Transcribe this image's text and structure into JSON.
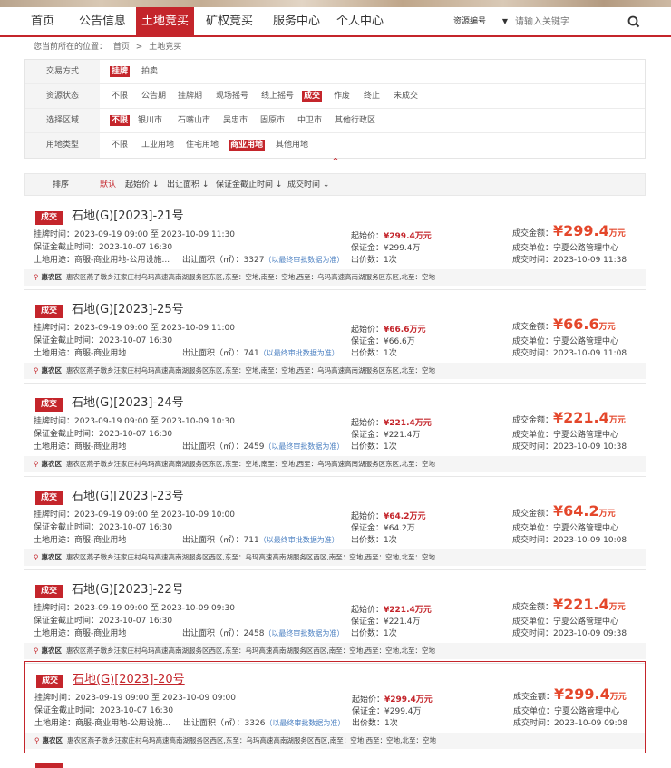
{
  "nav": {
    "items": [
      "首页",
      "公告信息",
      "土地竞买",
      "矿权竞买",
      "服务中心",
      "个人中心"
    ],
    "active_index": 2,
    "search_select": "资源编号",
    "search_placeholder": "请输入关键字"
  },
  "breadcrumb": {
    "prefix": "您当前所在的位置：",
    "home": "首页",
    "sep": ">",
    "current": "土地竞买"
  },
  "filters": [
    {
      "label": "交易方式",
      "options": [
        "挂牌",
        "拍卖"
      ],
      "selected": "挂牌"
    },
    {
      "label": "资源状态",
      "options": [
        "不限",
        "公告期",
        "挂牌期",
        "现场摇号",
        "线上摇号",
        "成交",
        "作废",
        "终止",
        "未成交"
      ],
      "selected": "成交"
    },
    {
      "label": "选择区域",
      "options": [
        "不限",
        "银川市",
        "石嘴山市",
        "吴忠市",
        "固原市",
        "中卫市",
        "其他行政区"
      ],
      "selected": "不限"
    },
    {
      "label": "用地类型",
      "options": [
        "不限",
        "工业用地",
        "住宅用地",
        "商业用地",
        "其他用地"
      ],
      "selected": "商业用地"
    }
  ],
  "sort": {
    "label": "排序",
    "options": [
      "默认",
      "起始价 ↓",
      "出让面积 ↓",
      "保证金截止时间 ↓",
      "成交时间 ↓"
    ],
    "active": "默认"
  },
  "listing_labels": {
    "badge": "成交",
    "listing_time": "挂牌时间：",
    "to": "至",
    "deposit_deadline": "保证金截止时间：",
    "land_use": "土地用途：",
    "area": "出让面积（㎡）：",
    "area_note": "（以最终审批数据为准）",
    "start_price": "起始价：",
    "deposit": "保证金：",
    "bid_count": "出价数：",
    "deal_amount": "成交金额：",
    "deal_unit": "成交单位：",
    "deal_time": "成交时间：",
    "district": "惠农区"
  },
  "listings": [
    {
      "title": "石地(G)[2023]-21号",
      "start": "2023-09-19 09:00",
      "end": "2023-10-09 11:30",
      "deposit_deadline": "2023-10-07 16:30",
      "land_use": "商服-商业用地-公用设施...",
      "area": "3327",
      "start_price": "¥299.4万元",
      "deposit": "¥299.4万",
      "bids": "1次",
      "deal_amount": "¥299.4",
      "deal_unit_suffix": "万元",
      "deal_unit": "宁夏公路管理中心",
      "deal_time": "2023-10-09 11:38",
      "location": "惠农区燕子墩乡汪家庄村乌玛高速高南湖服务区东区,东至：空地,南至：空地,西至：乌玛高速高南湖服务区东区,北至：空地"
    },
    {
      "title": "石地(G)[2023]-25号",
      "start": "2023-09-19 09:00",
      "end": "2023-10-09 11:00",
      "deposit_deadline": "2023-10-07 16:30",
      "land_use": "商服-商业用地",
      "area": "741",
      "start_price": "¥66.6万元",
      "deposit": "¥66.6万",
      "bids": "1次",
      "deal_amount": "¥66.6",
      "deal_unit_suffix": "万元",
      "deal_unit": "宁夏公路管理中心",
      "deal_time": "2023-10-09 11:08",
      "location": "惠农区燕子墩乡汪家庄村乌玛高速高南湖服务区东区,东至：空地,南至：空地,西至：乌玛高速高南湖服务区东区,北至：空地"
    },
    {
      "title": "石地(G)[2023]-24号",
      "start": "2023-09-19 09:00",
      "end": "2023-10-09 10:30",
      "deposit_deadline": "2023-10-07 16:30",
      "land_use": "商服-商业用地",
      "area": "2459",
      "start_price": "¥221.4万元",
      "deposit": "¥221.4万",
      "bids": "1次",
      "deal_amount": "¥221.4",
      "deal_unit_suffix": "万元",
      "deal_unit": "宁夏公路管理中心",
      "deal_time": "2023-10-09 10:38",
      "location": "惠农区燕子墩乡汪家庄村乌玛高速高南湖服务区东区,东至：空地,南至：空地,西至：乌玛高速高南湖服务区东区,北至：空地"
    },
    {
      "title": "石地(G)[2023]-23号",
      "start": "2023-09-19 09:00",
      "end": "2023-10-09 10:00",
      "deposit_deadline": "2023-10-07 16:30",
      "land_use": "商服-商业用地",
      "area": "711",
      "start_price": "¥64.2万元",
      "deposit": "¥64.2万",
      "bids": "1次",
      "deal_amount": "¥64.2",
      "deal_unit_suffix": "万元",
      "deal_unit": "宁夏公路管理中心",
      "deal_time": "2023-10-09 10:08",
      "location": "惠农区燕子墩乡汪家庄村乌玛高速高南湖服务区西区,东至：乌玛高速高南湖服务区西区,南至：空地,西至：空地,北至：空地"
    },
    {
      "title": "石地(G)[2023]-22号",
      "start": "2023-09-19 09:00",
      "end": "2023-10-09 09:30",
      "deposit_deadline": "2023-10-07 16:30",
      "land_use": "商服-商业用地",
      "area": "2458",
      "start_price": "¥221.4万元",
      "deposit": "¥221.4万",
      "bids": "1次",
      "deal_amount": "¥221.4",
      "deal_unit_suffix": "万元",
      "deal_unit": "宁夏公路管理中心",
      "deal_time": "2023-10-09 09:38",
      "location": "惠农区燕子墩乡汪家庄村乌玛高速高南湖服务区西区,东至：乌玛高速高南湖服务区西区,南至：空地,西至：空地,北至：空地"
    },
    {
      "title": "石地(G)[2023]-20号",
      "start": "2023-09-19 09:00",
      "end": "2023-10-09 09:00",
      "deposit_deadline": "2023-10-07 16:30",
      "land_use": "商服-商业用地-公用设施...",
      "area": "3326",
      "start_price": "¥299.4万元",
      "deposit": "¥299.4万",
      "bids": "1次",
      "deal_amount": "¥299.4",
      "deal_unit_suffix": "万元",
      "deal_unit": "宁夏公路管理中心",
      "deal_time": "2023-10-09 09:08",
      "location": "惠农区燕子墩乡汪家庄村乌玛高速高南湖服务区西区,东至：乌玛高速高南湖服务区西区,南至：空地,西至：空地,北至：空地"
    }
  ],
  "colors": {
    "accent": "#c4252b",
    "price": "#e4472b",
    "link": "#4a7fc1"
  }
}
